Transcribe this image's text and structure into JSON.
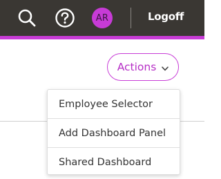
{
  "header": {
    "icons": {
      "search": "search-icon",
      "help": "help-circle-icon"
    },
    "avatar_initials": "AR",
    "logoff_label": "Logoff"
  },
  "actions": {
    "label": "Actions",
    "chevron_icon": "chevron-down-icon"
  },
  "menu": {
    "items": [
      {
        "label": "Employee Selector"
      },
      {
        "label": "Add Dashboard Panel"
      },
      {
        "label": "Shared Dashboard"
      }
    ]
  },
  "colors": {
    "topbar_bg": "#3a3733",
    "accent": "#c73bd6",
    "accent_text": "#b62ec6",
    "menu_text": "#333333"
  }
}
